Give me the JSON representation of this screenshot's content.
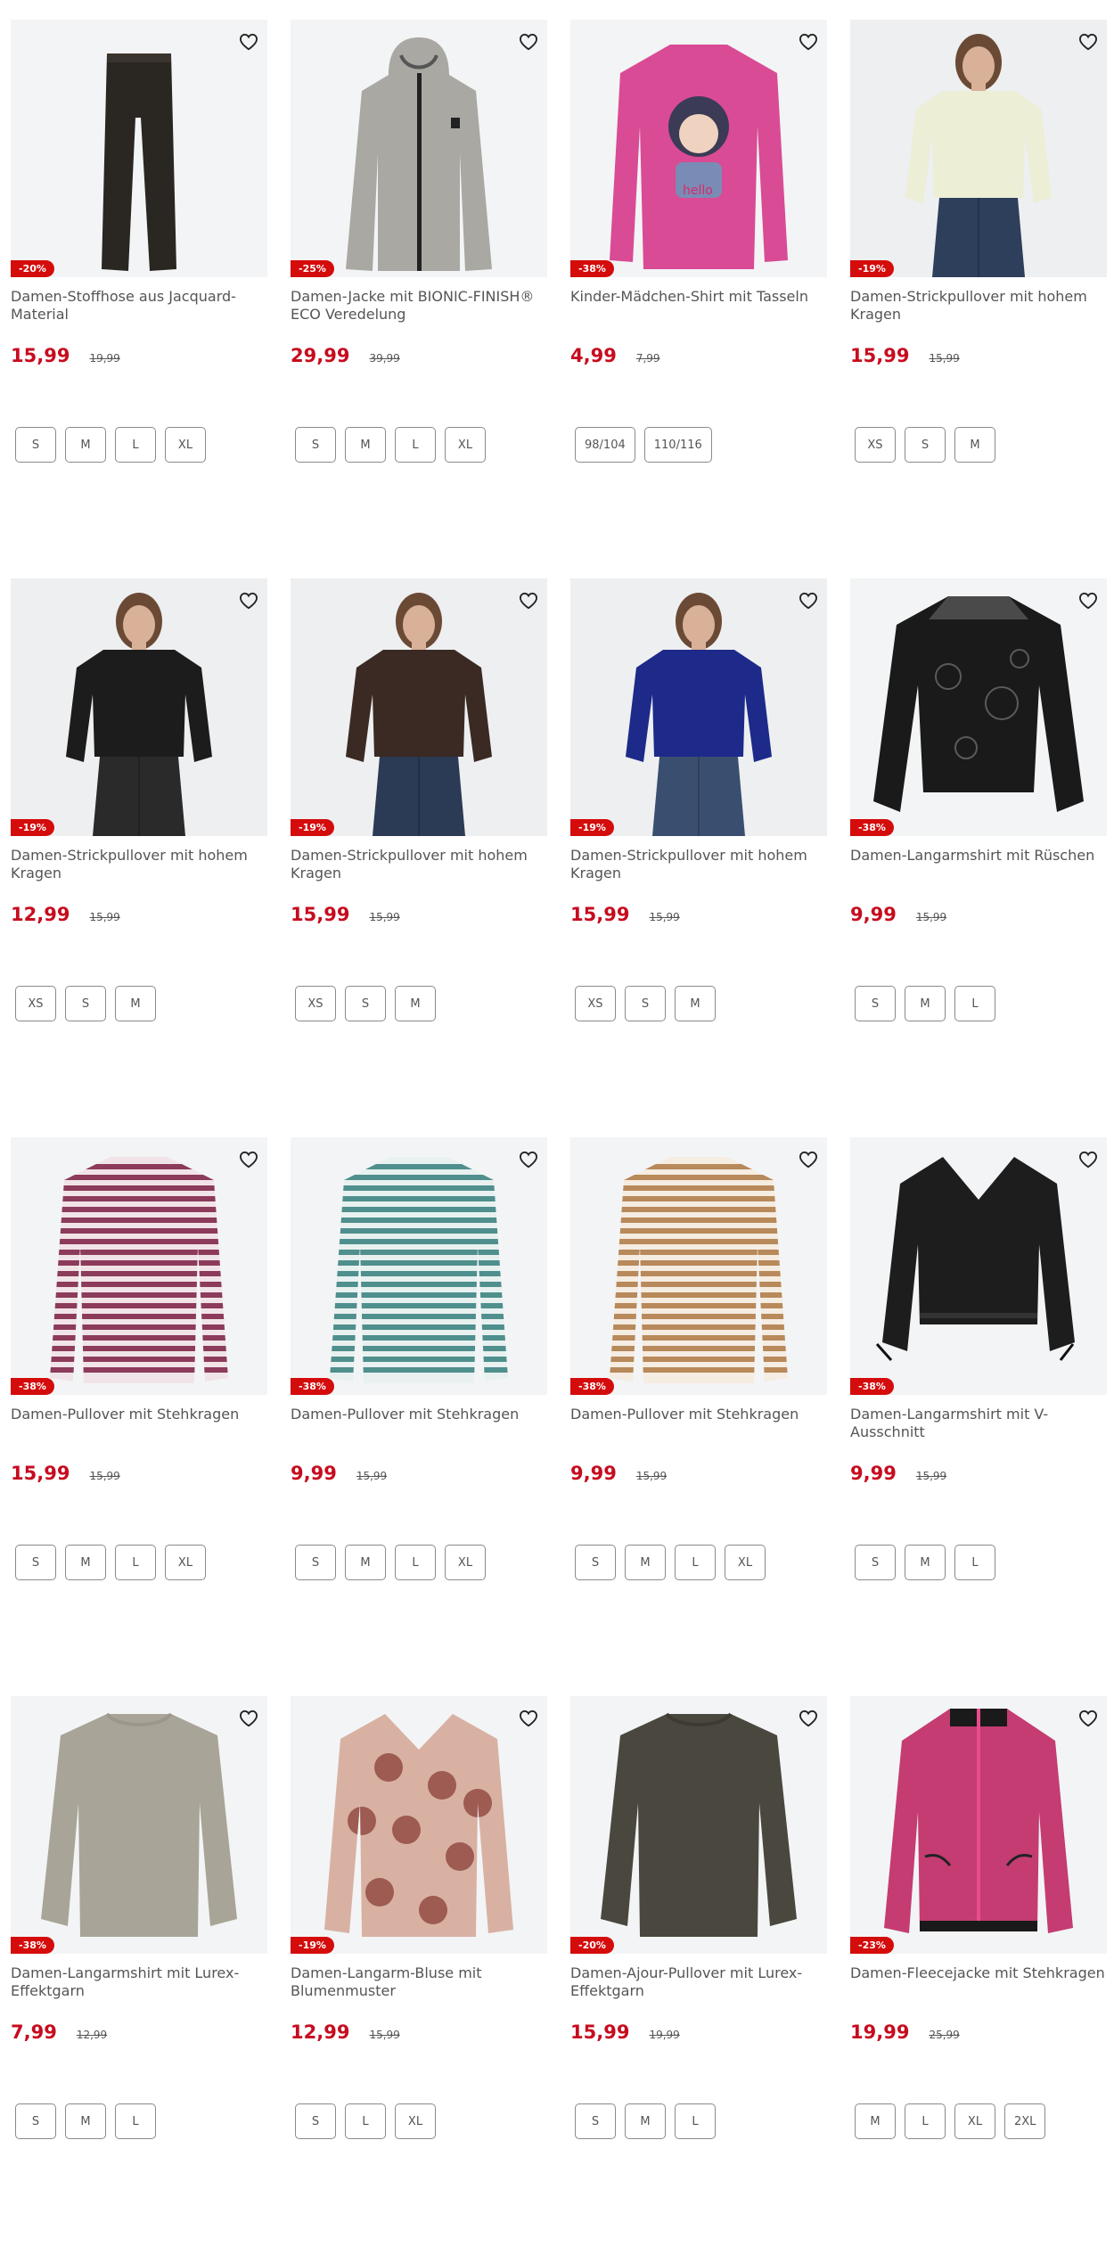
{
  "colors": {
    "sale_red": "#c70c1f",
    "badge_red": "#d40c0c",
    "image_bg": "#f3f4f5"
  },
  "products": [
    {
      "title": "Damen-Stoffhose aus Jacquard-Material",
      "badge": "-20%",
      "price": "15,99",
      "old_price": "19,99",
      "sizes": [
        "S",
        "M",
        "L",
        "XL"
      ],
      "garment": "pants",
      "color": "#2a2622",
      "color2": "#3a342e"
    },
    {
      "title": "Damen-Jacke mit BIONIC-FINISH® ECO Veredelung",
      "badge": "-25%",
      "price": "29,99",
      "old_price": "39,99",
      "sizes": [
        "S",
        "M",
        "L",
        "XL"
      ],
      "garment": "jacket",
      "color": "#a9a8a3",
      "color2": "#222222"
    },
    {
      "title": "Kinder-Mädchen-Shirt mit Tasseln",
      "badge": "-38%",
      "price": "4,99",
      "old_price": "7,99",
      "sizes": [
        "98/104",
        "110/116"
      ],
      "garment": "kidshirt",
      "color": "#d94b95",
      "color2": "#3b3b55"
    },
    {
      "title": "Damen-Strickpullover mit hohem Kragen",
      "badge": "-19%",
      "price": "15,99",
      "old_price": "15,99",
      "sizes": [
        "XS",
        "S",
        "M"
      ],
      "garment": "model",
      "color": "#eceed6",
      "color2": "#2e3f5c"
    },
    {
      "title": "Damen-Strickpullover mit hohem Kragen",
      "badge": "-19%",
      "price": "12,99",
      "old_price": "15,99",
      "sizes": [
        "XS",
        "S",
        "M"
      ],
      "garment": "model",
      "color": "#1c1c1c",
      "color2": "#2a2a2a"
    },
    {
      "title": "Damen-Strickpullover mit hohem Kragen",
      "badge": "-19%",
      "price": "15,99",
      "old_price": "15,99",
      "sizes": [
        "XS",
        "S",
        "M"
      ],
      "garment": "model",
      "color": "#3b2a24",
      "color2": "#2b3a55"
    },
    {
      "title": "Damen-Strickpullover mit hohem Kragen",
      "badge": "-19%",
      "price": "15,99",
      "old_price": "15,99",
      "sizes": [
        "XS",
        "S",
        "M"
      ],
      "garment": "model",
      "color": "#1d2a8a",
      "color2": "#3a4f70"
    },
    {
      "title": "Damen-Langarmshirt mit Rüschen",
      "badge": "-38%",
      "price": "9,99",
      "old_price": "15,99",
      "sizes": [
        "S",
        "M",
        "L"
      ],
      "garment": "lace",
      "color": "#1a1a1a",
      "color2": "#4a4a4a"
    },
    {
      "title": "Damen-Pullover mit Stehkragen",
      "badge": "-38%",
      "price": "15,99",
      "old_price": "15,99",
      "sizes": [
        "S",
        "M",
        "L",
        "XL"
      ],
      "garment": "striped",
      "color": "#8c3b5a",
      "color2": "#f1e4e8"
    },
    {
      "title": "Damen-Pullover mit Stehkragen",
      "badge": "-38%",
      "price": "9,99",
      "old_price": "15,99",
      "sizes": [
        "S",
        "M",
        "L",
        "XL"
      ],
      "garment": "striped",
      "color": "#4f8f8d",
      "color2": "#e8f1f0"
    },
    {
      "title": "Damen-Pullover mit Stehkragen",
      "badge": "-38%",
      "price": "9,99",
      "old_price": "15,99",
      "sizes": [
        "S",
        "M",
        "L",
        "XL"
      ],
      "garment": "striped",
      "color": "#b8895a",
      "color2": "#f5ece2"
    },
    {
      "title": "Damen-Langarmshirt mit V-Ausschnitt",
      "badge": "-38%",
      "price": "9,99",
      "old_price": "15,99",
      "sizes": [
        "S",
        "M",
        "L"
      ],
      "garment": "blouse",
      "color": "#1d1d1d",
      "color2": "#333333"
    },
    {
      "title": "Damen-Langarmshirt mit Lurex-Effektgarn",
      "badge": "-38%",
      "price": "7,99",
      "old_price": "12,99",
      "sizes": [
        "S",
        "M",
        "L"
      ],
      "garment": "sweater",
      "color": "#a8a598",
      "color2": "#9b988b"
    },
    {
      "title": "Damen-Langarm-Bluse mit Blumenmuster",
      "badge": "-19%",
      "price": "12,99",
      "old_price": "15,99",
      "sizes": [
        "S",
        "L",
        "XL"
      ],
      "garment": "floral",
      "color": "#d8b1a3",
      "color2": "#8a3f35"
    },
    {
      "title": "Damen-Ajour-Pullover mit Lurex-Effektgarn",
      "badge": "-20%",
      "price": "15,99",
      "old_price": "19,99",
      "sizes": [
        "S",
        "M",
        "L"
      ],
      "garment": "sweater",
      "color": "#4a473f",
      "color2": "#3d3a33"
    },
    {
      "title": "Damen-Fleecejacke mit Stehkragen",
      "badge": "-23%",
      "price": "19,99",
      "old_price": "25,99",
      "sizes": [
        "M",
        "L",
        "XL",
        "2XL"
      ],
      "garment": "fleece",
      "color": "#c43c72",
      "color2": "#1a1a1a"
    }
  ]
}
